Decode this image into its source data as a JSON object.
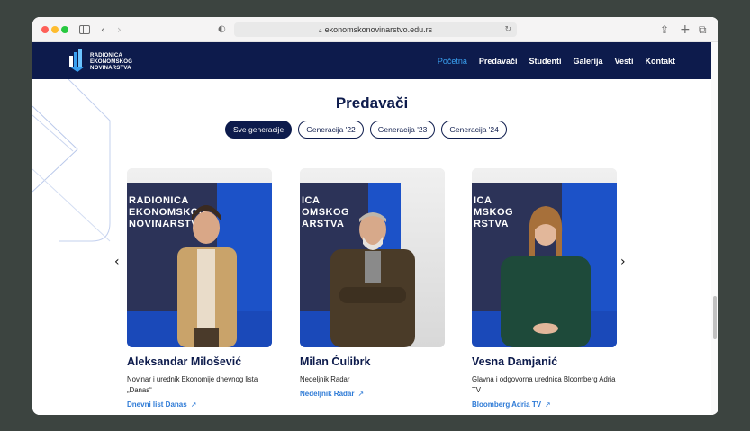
{
  "browser": {
    "url": "ekonomskonovinarstvo.edu.rs"
  },
  "site": {
    "logo_lines": [
      "RADIONICA",
      "EKONOMSKOG",
      "NOVINARSTVA"
    ],
    "nav": [
      {
        "label": "Početna",
        "active": true
      },
      {
        "label": "Predavači",
        "active": false
      },
      {
        "label": "Studenti",
        "active": false
      },
      {
        "label": "Galerija",
        "active": false
      },
      {
        "label": "Vesti",
        "active": false
      },
      {
        "label": "Kontakt",
        "active": false
      }
    ]
  },
  "section": {
    "title": "Predavači",
    "filters": [
      "Sve generacije",
      "Generacija '22",
      "Generacija '23",
      "Generacija '24"
    ],
    "active_filter": "Sve generacije"
  },
  "lecturers": [
    {
      "name": "Aleksandar Milošević",
      "description": "Novinar i urednik Ekonomije dnevnog lista „Danas“",
      "link": "Dnevni list Danas",
      "banner_text": [
        "RADIONICA",
        "EKONOMSKOG",
        "NOVINARSTVA"
      ]
    },
    {
      "name": "Milan Ćulibrk",
      "description": "Nedeljnik Radar",
      "link": "Nedeljnik Radar",
      "banner_text": [
        "ICA",
        "OMSKOG",
        "ARSTVA"
      ]
    },
    {
      "name": "Vesna Damjanić",
      "description": "Glavna i odgovorna urednica Bloomberg Adria TV",
      "link": "Bloomberg Adria TV",
      "banner_text": [
        "ICA",
        "MSKOG",
        "RSTVA"
      ]
    }
  ],
  "colors": {
    "navy": "#0d1b4c",
    "accent": "#3aa0f0",
    "link": "#2d7ad6"
  }
}
